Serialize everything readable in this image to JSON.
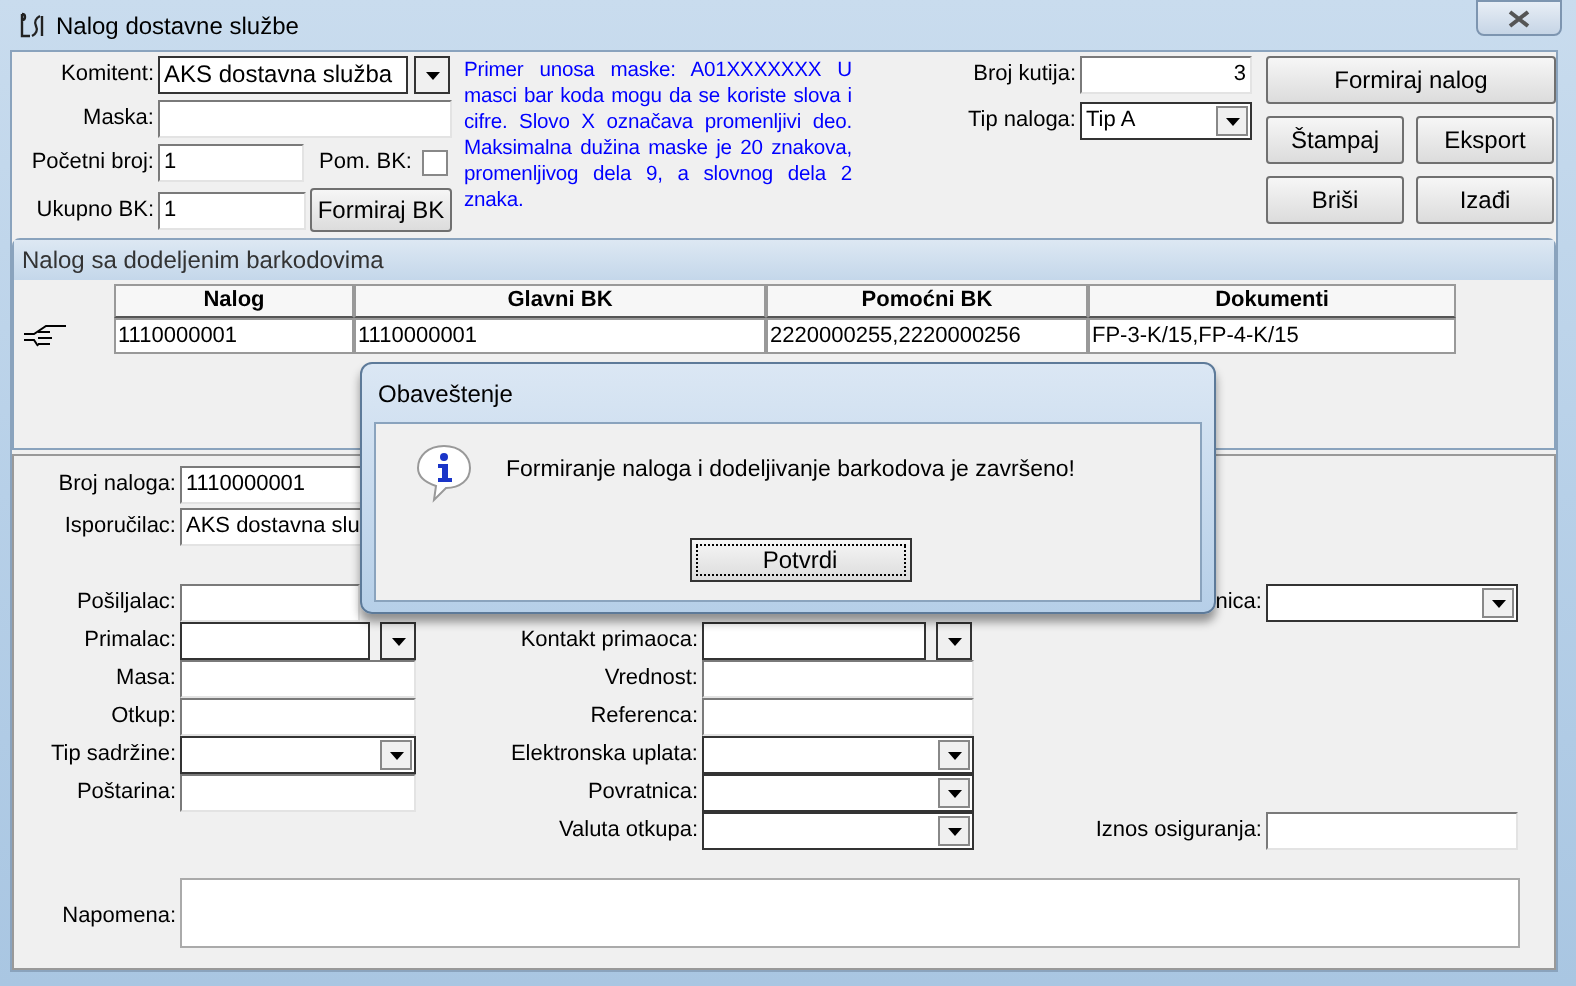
{
  "window": {
    "title": "Nalog dostavne službe"
  },
  "header": {
    "komitent": {
      "label": "Komitent:",
      "value": "AKS dostavna služba"
    },
    "maska": {
      "label": "Maska:"
    },
    "pocetni_broj": {
      "label": "Početni broj:",
      "value": "1"
    },
    "pom_bk": {
      "label": "Pom. BK:",
      "checked": false
    },
    "ukupno_bk": {
      "label": "Ukupno BK:",
      "value": "1"
    },
    "formiraj_bk": "Formiraj BK",
    "hint": "Primer unosa maske: A01XXXXXXX U masci bar koda mogu da se koriste slova i cifre. Slovo X označava promenljivi deo. Maksimalna dužina maske je 20 znakova, promenljivog dela 9, a slovnog dela 2 znaka.",
    "broj_kutija": {
      "label": "Broj kutija:",
      "value": "3"
    },
    "tip_naloga": {
      "label": "Tip naloga:",
      "value": "Tip A"
    },
    "buttons": [
      "Formiraj nalog",
      "Štampaj",
      "Eksport",
      "Briši",
      "Izađi"
    ]
  },
  "grid_panel": {
    "title": "Nalog sa dodeljenim barkodovima",
    "columns": [
      "Nalog",
      "Glavni BK",
      "Pomoćni BK",
      "Dokumenti"
    ],
    "rows": [
      {
        "cells": [
          "1110000001",
          "1110000001",
          "2220000255,2220000256",
          "FP-3-K/15,FP-4-K/15"
        ]
      }
    ]
  },
  "details": {
    "broj_naloga": {
      "label": "Broj naloga:",
      "value": "1110000001"
    },
    "isporucilac": {
      "label": "Isporučilac:",
      "value": "AKS dostavna slu"
    },
    "rows": [
      [
        {
          "label": "Pošiljalac:",
          "kind": "input"
        },
        null,
        {
          "label": "nica:",
          "kind": "combo"
        }
      ],
      [
        {
          "label": "Primalac:",
          "kind": "split"
        },
        {
          "label": "Kontakt primaoca:",
          "kind": "split"
        },
        null
      ],
      [
        {
          "label": "Masa:",
          "kind": "input"
        },
        {
          "label": "Vrednost:",
          "kind": "input"
        },
        null
      ],
      [
        {
          "label": "Otkup:",
          "kind": "input"
        },
        {
          "label": "Referenca:",
          "kind": "input"
        },
        null
      ],
      [
        {
          "label": "Tip sadržine:",
          "kind": "combo"
        },
        {
          "label": "Elektronska uplata:",
          "kind": "combo"
        },
        null
      ],
      [
        {
          "label": "Poštarina:",
          "kind": "input"
        },
        {
          "label": "Povratnica:",
          "kind": "combo"
        },
        null
      ],
      [
        null,
        {
          "label": "Valuta otkupa:",
          "kind": "combo"
        },
        {
          "label": "Iznos osiguranja:",
          "kind": "input"
        }
      ]
    ],
    "napomena": {
      "label": "Napomena:"
    }
  },
  "dialog": {
    "title": "Obaveštenje",
    "message": "Formiranje naloga i dodeljivanje barkodova je završeno!",
    "button": "Potvrdi"
  }
}
